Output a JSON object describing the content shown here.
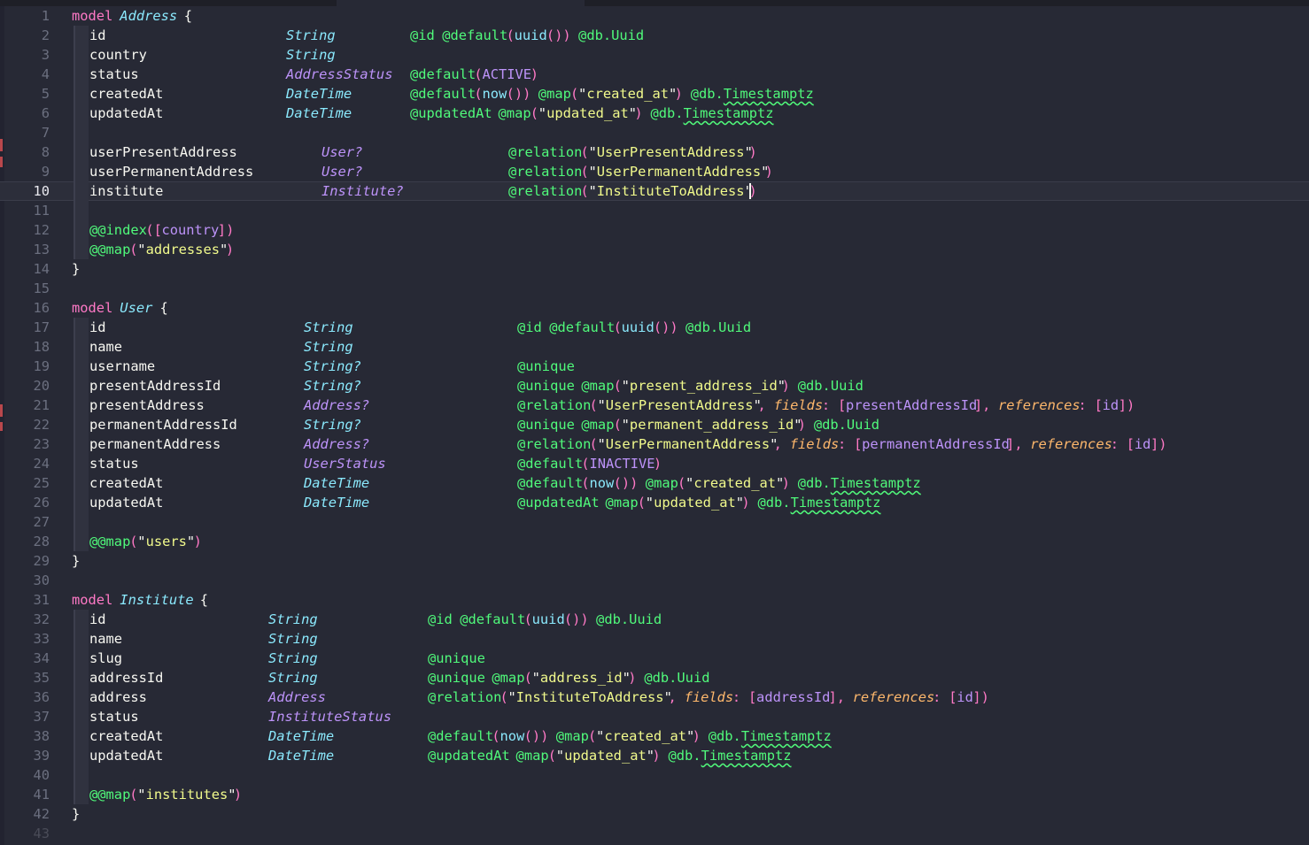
{
  "editor": {
    "current_line": 10,
    "cursor_after": "\"InstituteToAddress\"",
    "lines": [
      {
        "n": "1",
        "t": [
          [
            "kw",
            "model"
          ],
          [
            "model-name",
            "Address"
          ],
          [
            "brace",
            "{"
          ]
        ]
      },
      {
        "n": "2",
        "t": [
          [
            "field",
            "id"
          ],
          [
            "type",
            "String"
          ],
          [
            "attr",
            "@id"
          ],
          [
            "attr",
            "@default"
          ],
          [
            "pu",
            "("
          ],
          [
            "fn",
            "uuid"
          ],
          [
            "pu",
            "())"
          ],
          [
            "attr",
            "@db.Uuid"
          ]
        ]
      },
      {
        "n": "3",
        "t": [
          [
            "field",
            "country"
          ],
          [
            "type",
            "String"
          ]
        ]
      },
      {
        "n": "4",
        "t": [
          [
            "field",
            "status"
          ],
          [
            "enum",
            "AddressStatus"
          ],
          [
            "attr",
            "@default"
          ],
          [
            "pu",
            "("
          ],
          [
            "ref",
            "ACTIVE"
          ],
          [
            "pu",
            ")"
          ]
        ]
      },
      {
        "n": "5",
        "t": [
          [
            "field",
            "createdAt"
          ],
          [
            "type",
            "DateTime"
          ],
          [
            "attr",
            "@default"
          ],
          [
            "pu",
            "("
          ],
          [
            "fn",
            "now"
          ],
          [
            "pu",
            "())"
          ],
          [
            "attr",
            "@map"
          ],
          [
            "pu",
            "("
          ],
          [
            "str",
            "\"created_at\""
          ],
          [
            "pu",
            ")"
          ],
          [
            "attr",
            "@db.Timestamptz"
          ]
        ]
      },
      {
        "n": "6",
        "t": [
          [
            "field",
            "updatedAt"
          ],
          [
            "type",
            "DateTime"
          ],
          [
            "attr",
            "@updatedAt"
          ],
          [
            "attr",
            "@map"
          ],
          [
            "pu",
            "("
          ],
          [
            "str",
            "\"updated_at\""
          ],
          [
            "pu",
            ")"
          ],
          [
            "attr",
            "@db.Timestamptz"
          ]
        ]
      },
      {
        "n": "7",
        "t": []
      },
      {
        "n": "8",
        "t": [
          [
            "field",
            "userPresentAddress"
          ],
          [
            "enum",
            "User?"
          ],
          [
            "attr",
            "@relation"
          ],
          [
            "pu",
            "("
          ],
          [
            "str",
            "\"UserPresentAddress\""
          ],
          [
            "pu",
            ")"
          ]
        ]
      },
      {
        "n": "9",
        "t": [
          [
            "field",
            "userPermanentAddress"
          ],
          [
            "enum",
            "User?"
          ],
          [
            "attr",
            "@relation"
          ],
          [
            "pu",
            "("
          ],
          [
            "str",
            "\"UserPermanentAddress\""
          ],
          [
            "pu",
            ")"
          ]
        ]
      },
      {
        "n": "10",
        "t": [
          [
            "field",
            "institute"
          ],
          [
            "enum",
            "Institute?"
          ],
          [
            "attr",
            "@relation"
          ],
          [
            "pu",
            "("
          ],
          [
            "str",
            "\"InstituteToAddress\""
          ],
          [
            "pu",
            ")"
          ]
        ]
      },
      {
        "n": "11",
        "t": []
      },
      {
        "n": "12",
        "t": [
          [
            "attr",
            "@@index"
          ],
          [
            "pu",
            "(["
          ],
          [
            "ref",
            "country"
          ],
          [
            "pu",
            "])"
          ]
        ]
      },
      {
        "n": "13",
        "t": [
          [
            "attr",
            "@@map"
          ],
          [
            "pu",
            "("
          ],
          [
            "str",
            "\"addresses\""
          ],
          [
            "pu",
            ")"
          ]
        ]
      },
      {
        "n": "14",
        "t": [
          [
            "brace",
            "}"
          ]
        ]
      },
      {
        "n": "15",
        "t": []
      },
      {
        "n": "16",
        "t": [
          [
            "kw",
            "model"
          ],
          [
            "model-name",
            "User"
          ],
          [
            "brace",
            "{"
          ]
        ]
      },
      {
        "n": "17",
        "t": [
          [
            "field",
            "id"
          ],
          [
            "type",
            "String"
          ],
          [
            "attr",
            "@id"
          ],
          [
            "attr",
            "@default"
          ],
          [
            "pu",
            "("
          ],
          [
            "fn",
            "uuid"
          ],
          [
            "pu",
            "())"
          ],
          [
            "attr",
            "@db.Uuid"
          ]
        ]
      },
      {
        "n": "18",
        "t": [
          [
            "field",
            "name"
          ],
          [
            "type",
            "String"
          ]
        ]
      },
      {
        "n": "19",
        "t": [
          [
            "field",
            "username"
          ],
          [
            "type",
            "String?"
          ],
          [
            "attr",
            "@unique"
          ]
        ]
      },
      {
        "n": "20",
        "t": [
          [
            "field",
            "presentAddressId"
          ],
          [
            "type",
            "String?"
          ],
          [
            "attr",
            "@unique"
          ],
          [
            "attr",
            "@map"
          ],
          [
            "pu",
            "("
          ],
          [
            "str",
            "\"present_address_id\""
          ],
          [
            "pu",
            ")"
          ],
          [
            "attr",
            "@db.Uuid"
          ]
        ]
      },
      {
        "n": "21",
        "t": [
          [
            "field",
            "presentAddress"
          ],
          [
            "enum",
            "Address?"
          ],
          [
            "attr",
            "@relation"
          ],
          [
            "pu",
            "("
          ],
          [
            "str",
            "\"UserPresentAddress\""
          ],
          [
            "pu",
            ","
          ],
          [
            "argk",
            "fields"
          ],
          [
            "pu",
            ":"
          ],
          [
            "pu",
            "["
          ],
          [
            "ref",
            "presentAddressId"
          ],
          [
            "pu",
            "],"
          ],
          [
            "argk",
            "references"
          ],
          [
            "pu",
            ":"
          ],
          [
            "pu",
            "["
          ],
          [
            "ref",
            "id"
          ],
          [
            "pu",
            "])"
          ]
        ]
      },
      {
        "n": "22",
        "t": [
          [
            "field",
            "permanentAddressId"
          ],
          [
            "type",
            "String?"
          ],
          [
            "attr",
            "@unique"
          ],
          [
            "attr",
            "@map"
          ],
          [
            "pu",
            "("
          ],
          [
            "str",
            "\"permanent_address_id\""
          ],
          [
            "pu",
            ")"
          ],
          [
            "attr",
            "@db.Uuid"
          ]
        ]
      },
      {
        "n": "23",
        "t": [
          [
            "field",
            "permanentAddress"
          ],
          [
            "enum",
            "Address?"
          ],
          [
            "attr",
            "@relation"
          ],
          [
            "pu",
            "("
          ],
          [
            "str",
            "\"UserPermanentAddress\""
          ],
          [
            "pu",
            ","
          ],
          [
            "argk",
            "fields"
          ],
          [
            "pu",
            ":"
          ],
          [
            "pu",
            "["
          ],
          [
            "ref",
            "permanentAddressId"
          ],
          [
            "pu",
            "],"
          ],
          [
            "argk",
            "references"
          ],
          [
            "pu",
            ":"
          ],
          [
            "pu",
            "["
          ],
          [
            "ref",
            "id"
          ],
          [
            "pu",
            "])"
          ]
        ]
      },
      {
        "n": "24",
        "t": [
          [
            "field",
            "status"
          ],
          [
            "enum",
            "UserStatus"
          ],
          [
            "attr",
            "@default"
          ],
          [
            "pu",
            "("
          ],
          [
            "ref",
            "INACTIVE"
          ],
          [
            "pu",
            ")"
          ]
        ]
      },
      {
        "n": "25",
        "t": [
          [
            "field",
            "createdAt"
          ],
          [
            "type",
            "DateTime"
          ],
          [
            "attr",
            "@default"
          ],
          [
            "pu",
            "("
          ],
          [
            "fn",
            "now"
          ],
          [
            "pu",
            "())"
          ],
          [
            "attr",
            "@map"
          ],
          [
            "pu",
            "("
          ],
          [
            "str",
            "\"created_at\""
          ],
          [
            "pu",
            ")"
          ],
          [
            "attr",
            "@db.Timestamptz"
          ]
        ]
      },
      {
        "n": "26",
        "t": [
          [
            "field",
            "updatedAt"
          ],
          [
            "type",
            "DateTime"
          ],
          [
            "attr",
            "@updatedAt"
          ],
          [
            "attr",
            "@map"
          ],
          [
            "pu",
            "("
          ],
          [
            "str",
            "\"updated_at\""
          ],
          [
            "pu",
            ")"
          ],
          [
            "attr",
            "@db.Timestamptz"
          ]
        ]
      },
      {
        "n": "27",
        "t": []
      },
      {
        "n": "28",
        "t": [
          [
            "attr",
            "@@map"
          ],
          [
            "pu",
            "("
          ],
          [
            "str",
            "\"users\""
          ],
          [
            "pu",
            ")"
          ]
        ]
      },
      {
        "n": "29",
        "t": [
          [
            "brace",
            "}"
          ]
        ]
      },
      {
        "n": "30",
        "t": []
      },
      {
        "n": "31",
        "t": [
          [
            "kw",
            "model"
          ],
          [
            "model-name",
            "Institute"
          ],
          [
            "brace",
            "{"
          ]
        ]
      },
      {
        "n": "32",
        "t": [
          [
            "field",
            "id"
          ],
          [
            "type",
            "String"
          ],
          [
            "attr",
            "@id"
          ],
          [
            "attr",
            "@default"
          ],
          [
            "pu",
            "("
          ],
          [
            "fn",
            "uuid"
          ],
          [
            "pu",
            "())"
          ],
          [
            "attr",
            "@db.Uuid"
          ]
        ]
      },
      {
        "n": "33",
        "t": [
          [
            "field",
            "name"
          ],
          [
            "type",
            "String"
          ]
        ]
      },
      {
        "n": "34",
        "t": [
          [
            "field",
            "slug"
          ],
          [
            "type",
            "String"
          ],
          [
            "attr",
            "@unique"
          ]
        ]
      },
      {
        "n": "35",
        "t": [
          [
            "field",
            "addressId"
          ],
          [
            "type",
            "String"
          ],
          [
            "attr",
            "@unique"
          ],
          [
            "attr",
            "@map"
          ],
          [
            "pu",
            "("
          ],
          [
            "str",
            "\"address_id\""
          ],
          [
            "pu",
            ")"
          ],
          [
            "attr",
            "@db.Uuid"
          ]
        ]
      },
      {
        "n": "36",
        "t": [
          [
            "field",
            "address"
          ],
          [
            "enum",
            "Address"
          ],
          [
            "attr",
            "@relation"
          ],
          [
            "pu",
            "("
          ],
          [
            "str",
            "\"InstituteToAddress\""
          ],
          [
            "pu",
            ","
          ],
          [
            "argk",
            "fields"
          ],
          [
            "pu",
            ":"
          ],
          [
            "pu",
            "["
          ],
          [
            "ref",
            "addressId"
          ],
          [
            "pu",
            "],"
          ],
          [
            "argk",
            "references"
          ],
          [
            "pu",
            ":"
          ],
          [
            "pu",
            "["
          ],
          [
            "ref",
            "id"
          ],
          [
            "pu",
            "])"
          ]
        ]
      },
      {
        "n": "37",
        "t": [
          [
            "field",
            "status"
          ],
          [
            "enum",
            "InstituteStatus"
          ]
        ]
      },
      {
        "n": "38",
        "t": [
          [
            "field",
            "createdAt"
          ],
          [
            "type",
            "DateTime"
          ],
          [
            "attr",
            "@default"
          ],
          [
            "pu",
            "("
          ],
          [
            "fn",
            "now"
          ],
          [
            "pu",
            "())"
          ],
          [
            "attr",
            "@map"
          ],
          [
            "pu",
            "("
          ],
          [
            "str",
            "\"created_at\""
          ],
          [
            "pu",
            ")"
          ],
          [
            "attr",
            "@db.Timestamptz"
          ]
        ]
      },
      {
        "n": "39",
        "t": [
          [
            "field",
            "updatedAt"
          ],
          [
            "type",
            "DateTime"
          ],
          [
            "attr",
            "@updatedAt"
          ],
          [
            "attr",
            "@map"
          ],
          [
            "pu",
            "("
          ],
          [
            "str",
            "\"updated_at\""
          ],
          [
            "pu",
            ")"
          ],
          [
            "attr",
            "@db.Timestamptz"
          ]
        ]
      },
      {
        "n": "40",
        "t": []
      },
      {
        "n": "41",
        "t": [
          [
            "attr",
            "@@map"
          ],
          [
            "pu",
            "("
          ],
          [
            "str",
            "\"institutes\""
          ],
          [
            "pu",
            ")"
          ]
        ]
      },
      {
        "n": "42",
        "t": [
          [
            "brace",
            "}"
          ]
        ]
      },
      {
        "n": "43",
        "t": []
      }
    ]
  }
}
